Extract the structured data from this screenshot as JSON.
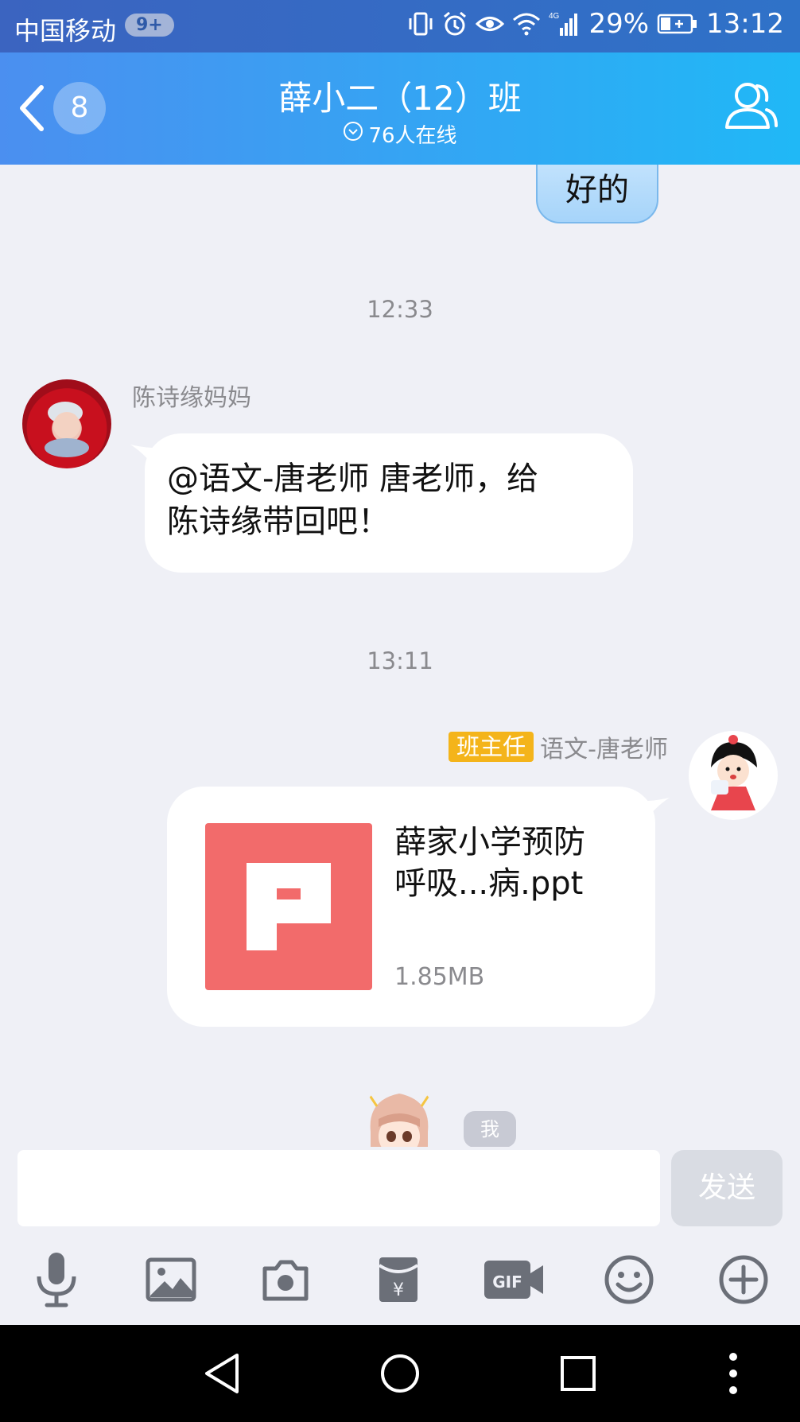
{
  "status_bar": {
    "carrier": "中国移动",
    "notif_badge": "9+",
    "battery": "29%",
    "time": "13:12"
  },
  "header": {
    "unread_count": "8",
    "title": "薛小二（12）班",
    "online": "76人在线"
  },
  "messages": {
    "prev_bubble": "好的",
    "time1": "12:33",
    "msg1": {
      "sender": "陈诗缘妈妈",
      "text_line1": "@语文-唐老师 唐老师，给",
      "text_line2": "陈诗缘带回吧！"
    },
    "time2": "13:11",
    "msg2": {
      "role": "班主任",
      "sender": "语文-唐老师",
      "file_name_line1": "薛家小学预防",
      "file_name_line2": "呼吸...病.ppt",
      "file_size": "1.85MB"
    },
    "me_tag": "我"
  },
  "input": {
    "send_label": "发送"
  },
  "toolbar": {
    "icons": [
      "microphone-icon",
      "image-icon",
      "camera-icon",
      "red-packet-icon",
      "gif-icon",
      "emoji-icon",
      "plus-icon"
    ]
  },
  "colors": {
    "header_start": "#4b8ff0",
    "header_end": "#20b8f6",
    "file_icon": "#f26b6b",
    "role_badge": "#f4b41a"
  }
}
